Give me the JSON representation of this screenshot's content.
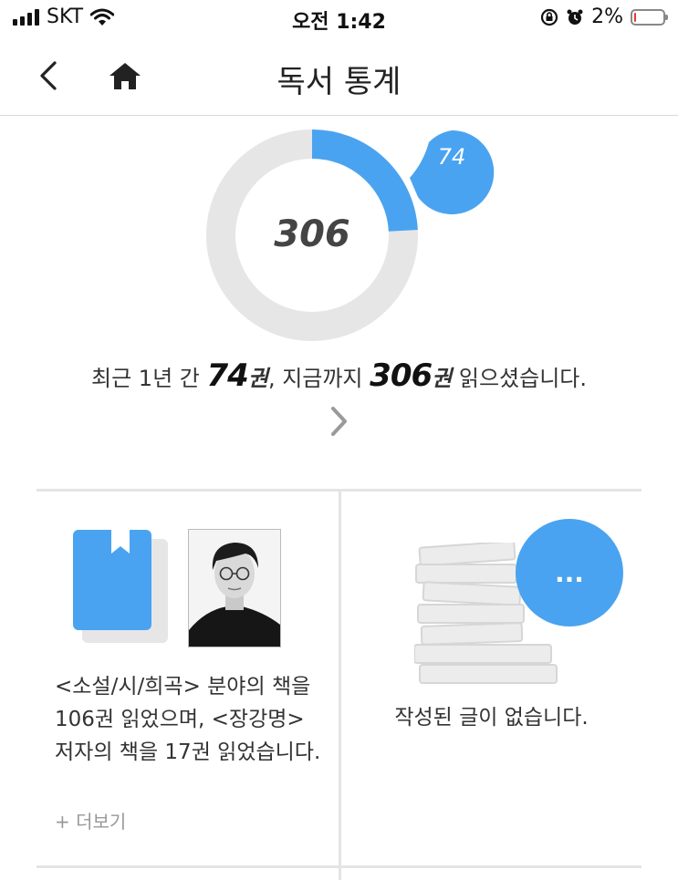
{
  "status_bar": {
    "carrier": "SKT",
    "time": "오전 1:42",
    "battery_text": "2%",
    "battery_level": 0.02,
    "icons": [
      "signal-icon",
      "wifi-icon",
      "rotation-lock-icon",
      "alarm-icon",
      "battery-icon"
    ]
  },
  "nav": {
    "title": "독서 통계",
    "back_icon": "chevron-left-icon",
    "home_icon": "home-icon"
  },
  "reading_stats": {
    "total_books": "306",
    "recent_books": "74",
    "recent_value": 74,
    "total_value": 306,
    "summary_prefix": "최근 1년 간",
    "summary_recent": "74",
    "summary_unit_1": "권",
    "summary_middle": ", 지금까지",
    "summary_total": "306",
    "summary_unit_2": "권",
    "summary_suffix": "읽으셨습니다.",
    "accent_color": "#4aa3f0",
    "track_color": "#e6e6e6"
  },
  "genre_card": {
    "text": "<소설/시/희곡> 분야의 책을 106권 읽었으며, <장강명> 저자의 책을 17권 읽었습니다.",
    "more_label": "+ 더보기"
  },
  "review_card": {
    "write_button_label": "...",
    "empty_text": "작성된 글이 없습니다."
  }
}
